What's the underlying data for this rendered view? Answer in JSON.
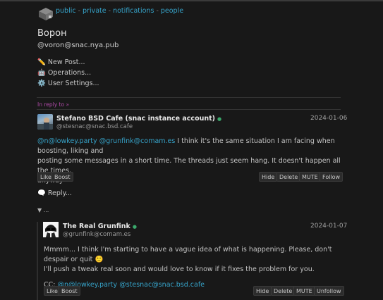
{
  "nav": {
    "public": "public",
    "private": "private",
    "notifications": "notifications",
    "people": "people",
    "sep": "-"
  },
  "profile": {
    "name": "Ворон",
    "handle": "@voron@snac.nya.pub"
  },
  "menu": {
    "new_post": "New Post...",
    "operations": "Operations...",
    "user_settings": "User Settings..."
  },
  "reply_to": "In reply to »",
  "post1": {
    "author": "Stefano BSD Cafe (snac instance account)",
    "account": "@stesnac@snac.bsd.cafe",
    "date": "2024-01-06",
    "mention1": "@n@lowkey.party",
    "mention2": "@grunfink@comam.es",
    "line1": "I think it's the same situation I am facing when boosting, liking and",
    "line2": "posting some messages in a short time. The threads just seem hang. It doesn't happen all the times,",
    "line3": "anyway",
    "like": "Like",
    "boost": "Boost",
    "hide": "Hide",
    "delete": "Delete",
    "mute": "MUTE",
    "follow": "Follow"
  },
  "reply_label": "Reply...",
  "collapse_label": "...",
  "post2": {
    "author": "The Real Grunfink",
    "account": "@grunfink@comam.es",
    "date": "2024-01-07",
    "line1": "Mmmm... I think I'm starting to have a vague idea of what is happening. Please, don't despair or quit",
    "line2": "I'll push a tweak real soon and would love to know if it fixes the problem for you.",
    "cc": "CC:",
    "cc1": "@n@lowkey.party",
    "cc2": "@stesnac@snac.bsd.cafe",
    "like": "Like",
    "boost": "Boost",
    "hide": "Hide",
    "delete": "Delete",
    "mute": "MUTE",
    "unfollow": "Unfollow"
  }
}
